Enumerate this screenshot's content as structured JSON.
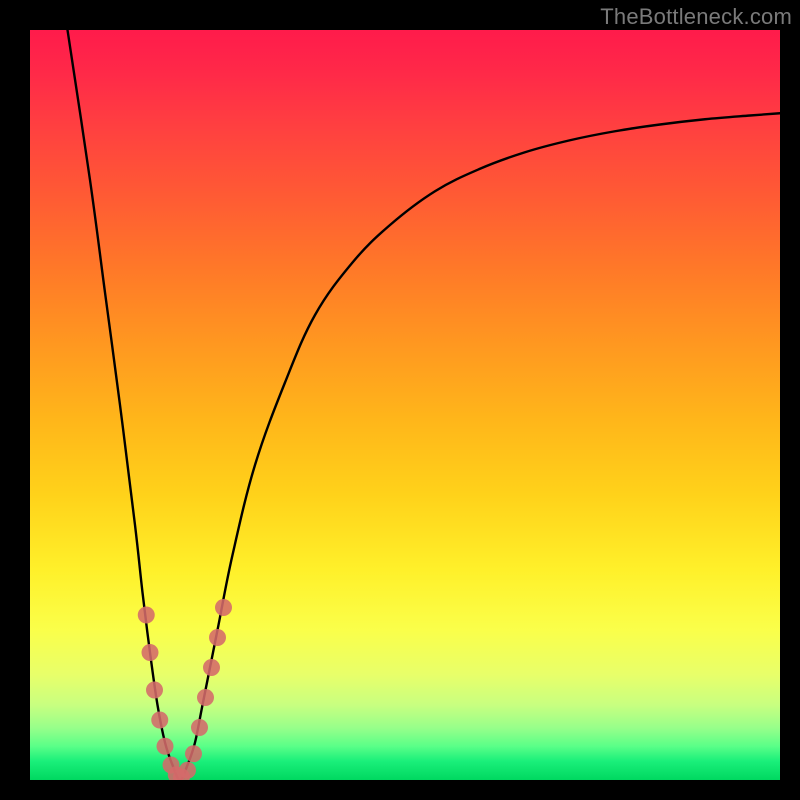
{
  "watermark": "TheBottleneck.com",
  "chart_data": {
    "type": "line",
    "title": "",
    "xlabel": "",
    "ylabel": "",
    "xlim": [
      0,
      100
    ],
    "ylim": [
      0,
      100
    ],
    "series": [
      {
        "name": "bottleneck-curve",
        "x": [
          5,
          8,
          10,
          12,
          14,
          15,
          16,
          17,
          18,
          19,
          20,
          21,
          22,
          23,
          25,
          27,
          30,
          34,
          38,
          43,
          48,
          54,
          60,
          66,
          72,
          78,
          84,
          90,
          96,
          100
        ],
        "values": [
          100,
          80,
          65,
          50,
          34,
          25,
          17,
          10,
          5,
          2,
          0,
          2,
          5,
          10,
          20,
          30,
          42,
          53,
          62,
          69,
          74,
          78.5,
          81.5,
          83.7,
          85.3,
          86.5,
          87.4,
          88.1,
          88.6,
          88.9
        ]
      }
    ],
    "markers": {
      "name": "sample-points",
      "color": "#d46a6a",
      "points": [
        {
          "x": 15.5,
          "y": 22
        },
        {
          "x": 16.0,
          "y": 17
        },
        {
          "x": 16.6,
          "y": 12
        },
        {
          "x": 17.3,
          "y": 8
        },
        {
          "x": 18.0,
          "y": 4.5
        },
        {
          "x": 18.8,
          "y": 2
        },
        {
          "x": 19.5,
          "y": 0.7
        },
        {
          "x": 20.2,
          "y": 0.4
        },
        {
          "x": 21.0,
          "y": 1.3
        },
        {
          "x": 21.8,
          "y": 3.5
        },
        {
          "x": 22.6,
          "y": 7
        },
        {
          "x": 23.4,
          "y": 11
        },
        {
          "x": 24.2,
          "y": 15
        },
        {
          "x": 25.0,
          "y": 19
        },
        {
          "x": 25.8,
          "y": 23
        }
      ]
    },
    "background_gradient": {
      "top": "#ff1b4b",
      "mid": "#ffd21a",
      "bottom": "#00d860"
    }
  }
}
